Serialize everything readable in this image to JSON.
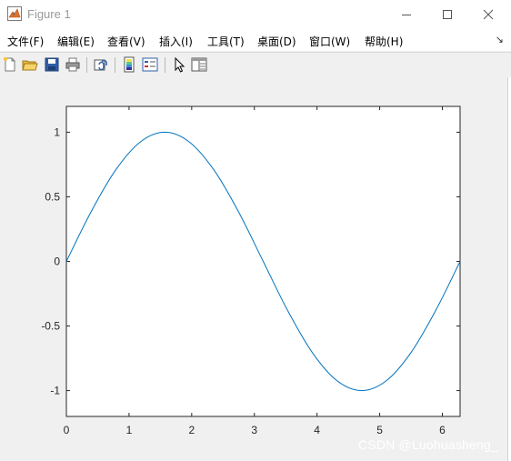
{
  "window": {
    "title": "Figure 1"
  },
  "menubar": {
    "items": [
      "文件(F)",
      "编辑(E)",
      "查看(V)",
      "插入(I)",
      "工具(T)",
      "桌面(D)",
      "窗口(W)",
      "帮助(H)"
    ],
    "overflow_arrow": "↘"
  },
  "toolbar": {
    "icons": [
      "new-figure-icon",
      "open-file-icon",
      "save-icon",
      "print-icon",
      "link-plot-icon",
      "colorbar-icon",
      "legend-icon",
      "pointer-icon",
      "property-editor-icon"
    ]
  },
  "chart_data": {
    "type": "line",
    "title": "",
    "xlabel": "",
    "ylabel": "",
    "xlim": [
      0,
      6.2832
    ],
    "ylim": [
      -1.2,
      1.2
    ],
    "xticks": [
      0,
      1,
      2,
      3,
      4,
      5,
      6
    ],
    "xtick_labels": [
      "0",
      "1",
      "2",
      "3",
      "4",
      "5",
      "6"
    ],
    "yticks": [
      1,
      0.5,
      0,
      -0.5,
      -1
    ],
    "ytick_labels": [
      "1",
      "0.5",
      "0",
      "-0.5",
      "-1"
    ],
    "grid": false,
    "series": [
      {
        "color": "#0072bd",
        "x": [
          0,
          0.3927,
          0.7854,
          1.1781,
          1.5708,
          1.9635,
          2.3562,
          2.7489,
          3.1416,
          3.5343,
          3.927,
          4.3197,
          4.7124,
          5.1051,
          5.4978,
          5.8905,
          6.2832
        ],
        "y": [
          0,
          0.383,
          0.707,
          0.924,
          1,
          0.924,
          0.707,
          0.383,
          0,
          -0.383,
          -0.707,
          -0.924,
          -1,
          -0.924,
          -0.707,
          -0.383,
          0
        ]
      }
    ]
  },
  "watermark": "CSDN @Luohuasheng_"
}
